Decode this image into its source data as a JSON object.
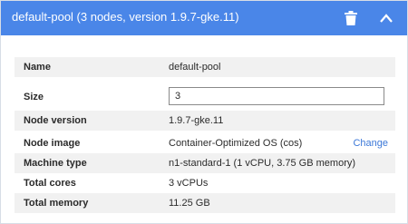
{
  "header": {
    "title": "default-pool (3 nodes, version 1.9.7-gke.11)",
    "delete_icon": "trash-icon",
    "collapse_icon": "chevron-up-icon",
    "accent_color": "#4a86e8"
  },
  "details": {
    "name": {
      "label": "Name",
      "value": "default-pool"
    },
    "size": {
      "label": "Size",
      "value": "3"
    },
    "node_version": {
      "label": "Node version",
      "value": "1.9.7-gke.11"
    },
    "node_image": {
      "label": "Node image",
      "value": "Container-Optimized OS (cos)",
      "action": "Change"
    },
    "machine_type": {
      "label": "Machine type",
      "value": "n1-standard-1 (1 vCPU, 3.75 GB memory)"
    },
    "total_cores": {
      "label": "Total cores",
      "value": "3 vCPUs"
    },
    "total_memory": {
      "label": "Total memory",
      "value": "11.25 GB"
    }
  }
}
